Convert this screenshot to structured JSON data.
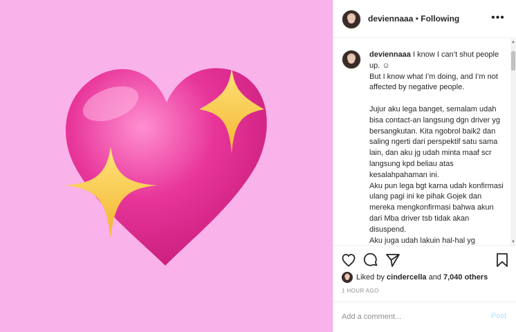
{
  "post": {
    "username": "deviennaaa",
    "separator": " • ",
    "follow_status": "Following"
  },
  "caption": {
    "username": "deviennaaa",
    "text": " I know I can’t shut people up. ☺\nBut I know what I’m doing, and I’m not affected by negative people.\n\nJujur aku lega banget, semalam udah bisa contact-an langsung dgn driver yg bersangkutan. Kita ngobrol baik2 dan saling ngerti dari perspektif satu sama lain, dan aku jg udah minta maaf scr langsung kpd beliau atas kesalahpahaman ini.\nAku pun lega bgt karna udah konfirmasi ulang pagi ini ke pihak Gojek dan mereka mengkonfirmasi bahwa akun dari Mba driver tsb tidak akan disuspend.\nAku juga udah lakuin hal-hal yg menurutku bisa dan perlu utk aku lakukan buat driver tsb diluar dari"
  },
  "likes": {
    "prefix": "Liked by ",
    "user": "cindercella",
    "middle": " and ",
    "count": "7,040 others"
  },
  "timestamp": "1 HOUR AGO",
  "comment": {
    "placeholder": "Add a comment...",
    "post_label": "Post"
  },
  "icons": {
    "like": "heart-outline-icon",
    "comment": "comment-bubble-icon",
    "share": "paper-plane-icon",
    "save": "bookmark-icon",
    "more": "more-dots-icon"
  },
  "colors": {
    "background": "#f9b2ea",
    "heart": "#e0338f",
    "sparkle": "#f8cc46",
    "post_disabled": "#b2dffc"
  }
}
